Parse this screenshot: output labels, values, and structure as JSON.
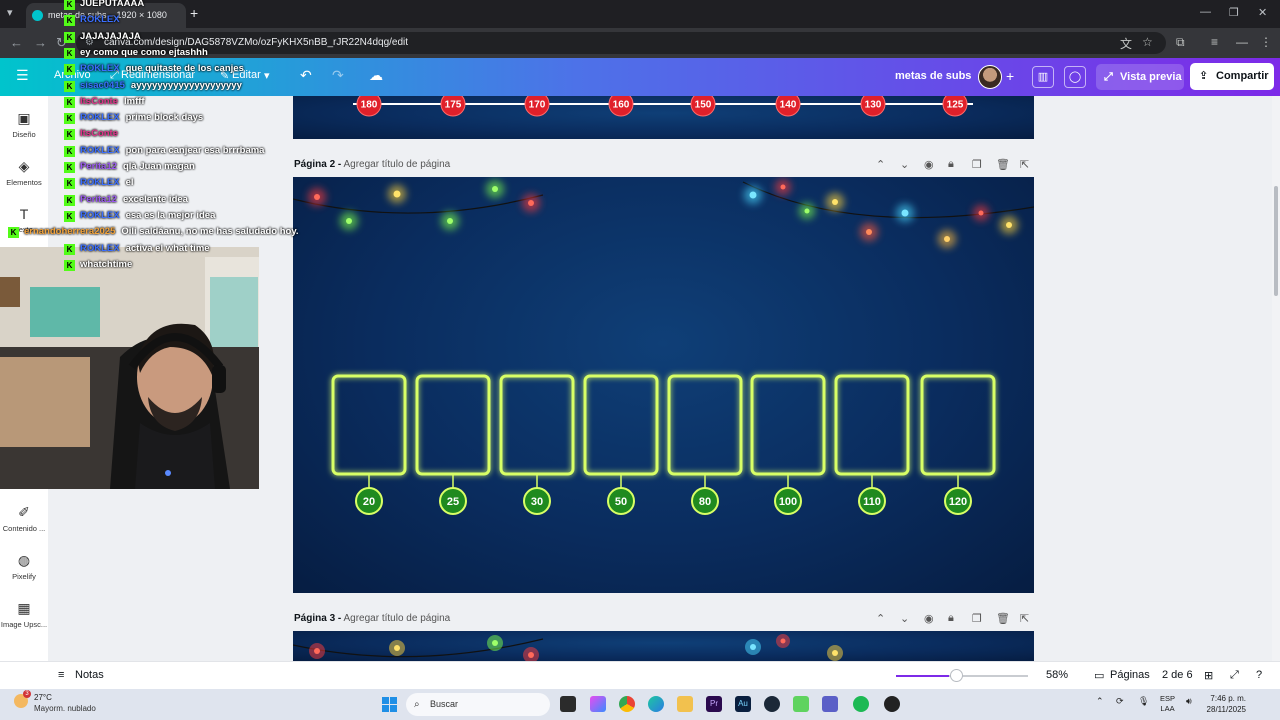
{
  "browser": {
    "tab_title": "metas de subs – 1920 × 1080",
    "url": "canva.com/design/DAG5878VZMo/ozFyKHX5nBB_rJR22N4dqg/edit"
  },
  "canva_header": {
    "menu_archivo": "Archivo",
    "menu_redimensionar": "Redimensionar",
    "menu_editar": "Editar",
    "design_title": "metas de subs",
    "preview_label": "Vista previa",
    "share_label": "Compartir"
  },
  "rail": {
    "items": [
      {
        "label": "Diseño",
        "icon": "layout-icon"
      },
      {
        "label": "Elementos",
        "icon": "elements-icon"
      },
      {
        "label": "Texto",
        "icon": "text-icon"
      },
      {
        "label": "Contenido ...",
        "icon": "magic-content-icon"
      },
      {
        "label": "Pixelify",
        "icon": "pixelify-app-icon"
      },
      {
        "label": "Image Upsc...",
        "icon": "image-upscaler-icon"
      }
    ]
  },
  "pages": {
    "page1_numbers": [
      "180",
      "175",
      "170",
      "160",
      "150",
      "140",
      "130",
      "125"
    ],
    "page2_label": "Página 2 -",
    "page2_subtitle": "Agregar título de página",
    "page2_numbers": [
      "20",
      "25",
      "30",
      "50",
      "80",
      "100",
      "110",
      "120"
    ],
    "page3_label": "Página 3 -",
    "page3_subtitle": "Agregar título de página"
  },
  "bottom_bar": {
    "notes": "Notas",
    "zoom": "58%",
    "zoom_fraction": 0.4,
    "pages_label": "Páginas",
    "page_count": "2 de 6"
  },
  "taskbar": {
    "temperature": "27°C",
    "weather_desc": "Mayorm. nublado",
    "weather_badge": "3",
    "search": "Buscar",
    "lang_top": "ESP",
    "lang_bottom": "LAA",
    "time": "7:46 p. m.",
    "date": "28/11/2025"
  },
  "chat": [
    {
      "user": "",
      "msg": "JUEPUTAAAA",
      "color": "#ff4d6a"
    },
    {
      "user": "ROKLEX",
      "msg": "",
      "color": "#3b6fff"
    },
    {
      "user": "",
      "msg": "JAJAJAJAJA",
      "color": "#e04545"
    },
    {
      "user": "",
      "msg": "ey como que como ejtashhh",
      "color": "#e04545"
    },
    {
      "user": "ROKLEX",
      "msg": "que quitaste de los canjes",
      "color": "#3b6fff"
    },
    {
      "user": "sisac0415",
      "msg": "ayyyyyyyyyyyyyyyyyyyy",
      "color": "#3b6fff"
    },
    {
      "user": "ItsConte",
      "msg": "lmfff",
      "color": "#e0338a"
    },
    {
      "user": "ROKLEX",
      "msg": "prime block days",
      "color": "#3b6fff"
    },
    {
      "user": "ItsConte",
      "msg": "",
      "color": "#e0338a"
    },
    {
      "user": "ROKLEX",
      "msg": "pon para canjear esa brrrbama",
      "color": "#3b6fff"
    },
    {
      "user": "Perita12",
      "msg": "qlà Juan magan",
      "color": "#9b59f0"
    },
    {
      "user": "ROKLEX",
      "msg": "el",
      "color": "#3b6fff"
    },
    {
      "user": "Perita12",
      "msg": "excelente idea",
      "color": "#9b59f0"
    },
    {
      "user": "ROKLEX",
      "msg": "esa es la mejor idea",
      "color": "#3b6fff"
    },
    {
      "user": "ernandoherrera2025",
      "msg": "Oili saldáanu, no me has saludado hoy.",
      "color": "#f2a33a"
    },
    {
      "user": "ROKLEX",
      "msg": "activa el what time",
      "color": "#3b6fff"
    },
    {
      "user": "",
      "msg": "whatchtime",
      "color": "#3b6fff"
    }
  ]
}
